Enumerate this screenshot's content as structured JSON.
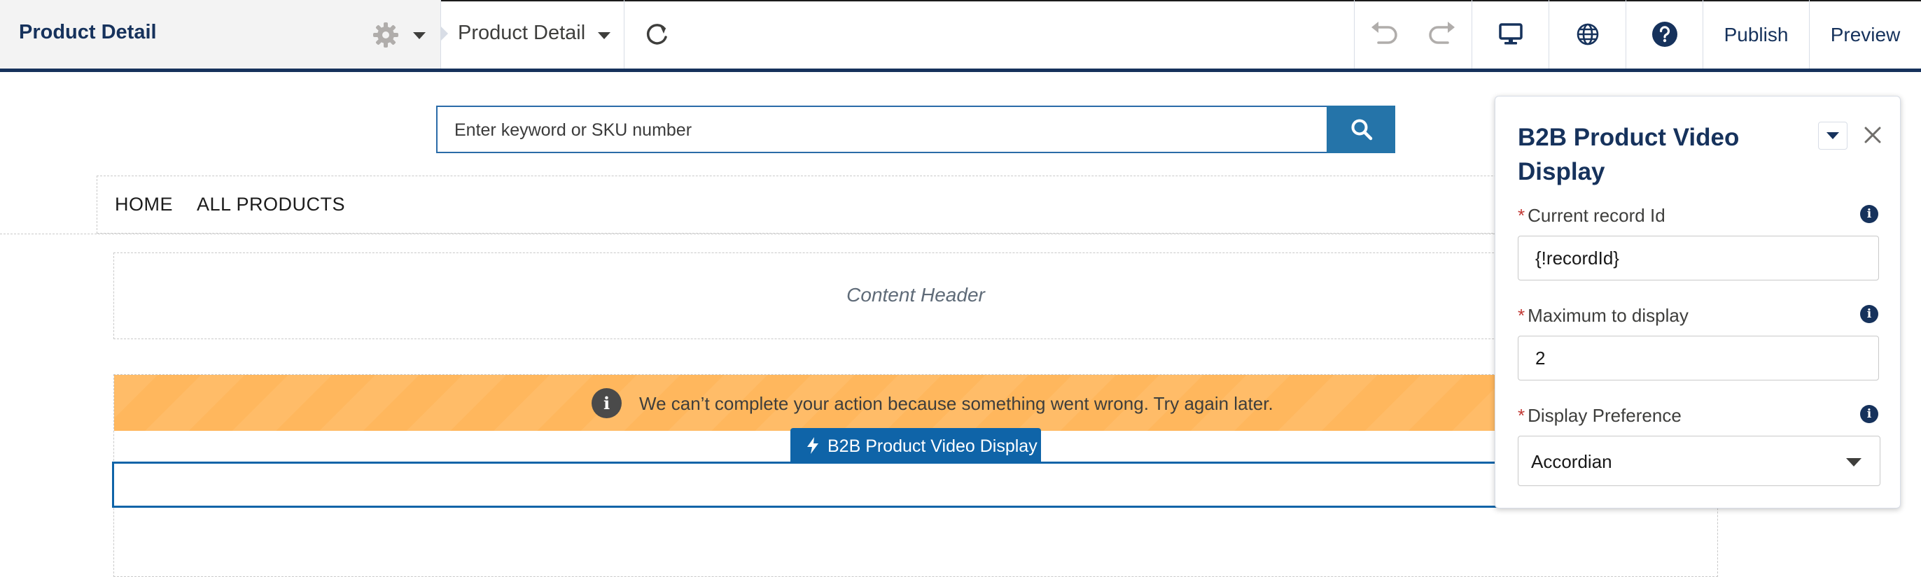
{
  "topbar": {
    "page_title": "Product Detail",
    "page_dropdown_label": "Product Detail",
    "publish_label": "Publish",
    "preview_label": "Preview",
    "icons": [
      "gear-icon",
      "refresh-icon",
      "undo-icon",
      "redo-icon",
      "desktop-icon",
      "globe-icon",
      "help-icon"
    ]
  },
  "canvas": {
    "search": {
      "placeholder": "Enter keyword or SKU number"
    },
    "nav": {
      "items": [
        "HOME",
        "ALL PRODUCTS"
      ]
    },
    "content_header_label": "Content Header",
    "error_message": "We can’t complete your action because something went wrong. Try again later.",
    "component_label": "B2B Product Video Display"
  },
  "panel": {
    "title": "B2B Product Video Display",
    "fields": [
      {
        "label": "Current record Id",
        "value": "{!recordId}",
        "required": "*"
      },
      {
        "label": "Maximum to display",
        "value": "2",
        "required": "*"
      },
      {
        "label": "Display Preference",
        "value": "Accordian",
        "required": "*"
      }
    ]
  },
  "colors": {
    "brand_navy": "#16325c",
    "button_blue": "#2574a9",
    "selection_blue": "#0f64a8",
    "warning_orange": "#ffb75d",
    "required_red": "#c23934"
  }
}
